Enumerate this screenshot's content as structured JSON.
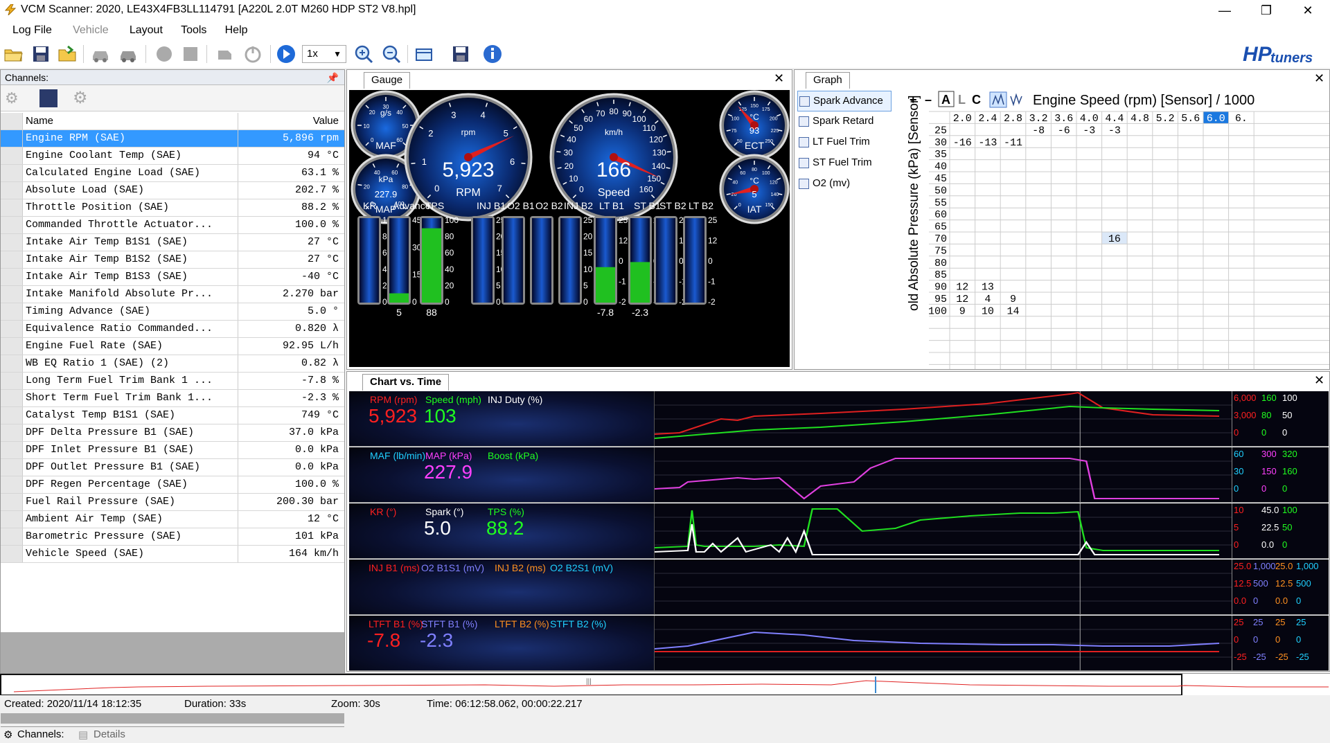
{
  "window": {
    "title": "VCM Scanner: 2020, LE43X4FB3LL114791 [A220L 2.0T M260 HDP ST2 V8.hpl]"
  },
  "menu": [
    "Log File",
    "Vehicle",
    "Layout",
    "Tools",
    "Help"
  ],
  "toolbar": {
    "speed": "1x",
    "logo": "HPtuners"
  },
  "channels": {
    "title": "Channels:",
    "header": {
      "name": "Name",
      "value": "Value"
    },
    "rows": [
      {
        "name": "Engine RPM (SAE)",
        "value": "5,896 rpm"
      },
      {
        "name": "Engine Coolant Temp (SAE)",
        "value": "94 °C"
      },
      {
        "name": "Calculated Engine Load (SAE)",
        "value": "63.1 %"
      },
      {
        "name": "Absolute Load (SAE)",
        "value": "202.7 %"
      },
      {
        "name": "Throttle Position (SAE)",
        "value": "88.2 %"
      },
      {
        "name": "Commanded Throttle Actuator...",
        "value": "100.0 %"
      },
      {
        "name": "Intake Air Temp B1S1 (SAE)",
        "value": "27 °C"
      },
      {
        "name": "Intake Air Temp B1S2 (SAE)",
        "value": "27 °C"
      },
      {
        "name": "Intake Air Temp B1S3 (SAE)",
        "value": "-40 °C"
      },
      {
        "name": "Intake Manifold Absolute Pr...",
        "value": "2.270 bar"
      },
      {
        "name": "Timing Advance (SAE)",
        "value": "5.0 °"
      },
      {
        "name": "Equivalence Ratio Commanded...",
        "value": "0.820 λ"
      },
      {
        "name": "Engine Fuel Rate (SAE)",
        "value": "92.95 L/h"
      },
      {
        "name": "WB EQ Ratio 1 (SAE) (2)",
        "value": "0.82 λ"
      },
      {
        "name": "Long Term Fuel Trim Bank 1 ...",
        "value": "-7.8 %"
      },
      {
        "name": "Short Term Fuel Trim Bank 1...",
        "value": "-2.3 %"
      },
      {
        "name": "Catalyst Temp B1S1 (SAE)",
        "value": "749 °C"
      },
      {
        "name": "DPF Delta Pressure B1 (SAE)",
        "value": "37.0 kPa"
      },
      {
        "name": "DPF Inlet Pressure B1 (SAE)",
        "value": "0.0 kPa"
      },
      {
        "name": "DPF Outlet Pressure B1 (SAE)",
        "value": "0.0 kPa"
      },
      {
        "name": "DPF Regen Percentage (SAE)",
        "value": "100.0 %"
      },
      {
        "name": "Fuel Rail Pressure (SAE)",
        "value": "200.30 bar"
      },
      {
        "name": "Ambient Air Temp (SAE)",
        "value": "12 °C"
      },
      {
        "name": "Barometric Pressure (SAE)",
        "value": "101 kPa"
      },
      {
        "name": "Vehicle Speed (SAE)",
        "value": "164 km/h"
      }
    ],
    "tabs": {
      "channels": "Channels:",
      "details": "Details"
    }
  },
  "gauge": {
    "tab": "Gauge",
    "rpm": {
      "unit": "rpm",
      "value": "5,923",
      "label": "RPM",
      "ticks": [
        "0",
        "1",
        "2",
        "3",
        "4",
        "5",
        "6",
        "7"
      ],
      "level": 5.923
    },
    "speed": {
      "unit": "km/h",
      "value": "166",
      "label": "Speed",
      "ticks": [
        "0",
        "10",
        "20",
        "30",
        "40",
        "50",
        "60",
        "70",
        "80",
        "90",
        "100",
        "110",
        "120",
        "130",
        "140",
        "150",
        "160"
      ],
      "level": 166
    },
    "maf": {
      "unit": "g/s",
      "label": "MAF",
      "ticks": [
        "0",
        "10",
        "20",
        "30",
        "40",
        "50",
        "60"
      ]
    },
    "map": {
      "unit": "kPa",
      "label": "MAP",
      "value": "227.9",
      "ticks": [
        "0",
        "20",
        "40",
        "60",
        "80",
        "100"
      ]
    },
    "ect": {
      "unit": "°C",
      "label": "ECT",
      "value": "93",
      "ticks": [
        "50",
        "75",
        "100",
        "125",
        "150",
        "175",
        "200",
        "225",
        "250"
      ]
    },
    "iat": {
      "unit": "°C",
      "label": "IAT",
      "value": "5",
      "ticks": [
        "0",
        "20",
        "40",
        "60",
        "80",
        "100",
        "120",
        "140",
        "150"
      ]
    },
    "bars": [
      {
        "label": "KR",
        "ticks": [
          "1",
          "8",
          "6",
          "4",
          "2",
          "0"
        ],
        "level": 0
      },
      {
        "label": "Advance",
        "ticks": [
          "45",
          "30",
          "15",
          "0"
        ],
        "level": 0.11,
        "value": "5"
      },
      {
        "label": "TPS",
        "ticks": [
          "100",
          "80",
          "60",
          "40",
          "20",
          "0"
        ],
        "level": 0.88,
        "value": "88"
      },
      {
        "label": "INJ B1",
        "ticks": [
          "25",
          "20",
          "15",
          "10",
          "5",
          "0"
        ],
        "level": 0
      },
      {
        "label": "O2 B1",
        "ticks": [],
        "level": 0
      },
      {
        "label": "O2 B2",
        "ticks": [],
        "level": 0
      },
      {
        "label": "INJ B2",
        "ticks": [
          "25",
          "20",
          "15",
          "10",
          "5",
          "0"
        ],
        "level": 0
      },
      {
        "label": "LT B1",
        "ticks": [
          "25",
          "12",
          "0",
          "-1",
          "-2"
        ],
        "level": 0.42,
        "value": "-7.8"
      },
      {
        "label": "ST B1",
        "ticks": [
          "25",
          "12",
          "0",
          "-1",
          "-2"
        ],
        "level": 0.48,
        "value": "-2.3"
      },
      {
        "label": "ST B2",
        "ticks": [
          "25",
          "12",
          "0",
          "-1",
          "-2"
        ],
        "level": 0
      },
      {
        "label": "LT B2",
        "ticks": [
          "25",
          "12",
          "0",
          "-1",
          "-2"
        ],
        "level": 0
      }
    ]
  },
  "graph": {
    "tab": "Graph",
    "items": [
      "Spark Advance",
      "Spark Retard",
      "LT Fuel Trim",
      "ST Fuel Trim",
      "O2 (mv)"
    ],
    "modes": [
      "+",
      "–",
      "A",
      "L",
      "C"
    ],
    "title": "Engine Speed (rpm) [Sensor] / 1000",
    "yaxis": "old Absolute Pressure (kPa) [Sensor]",
    "cols": [
      "2.0",
      "2.4",
      "2.8",
      "3.2",
      "3.6",
      "4.0",
      "4.4",
      "4.8",
      "5.2",
      "5.6",
      "6.0",
      "6."
    ],
    "rows": [
      {
        "k": "25",
        "c": [
          "",
          "",
          "",
          "-8",
          "-6",
          "-3",
          "-3",
          "",
          "",
          "",
          "",
          ""
        ]
      },
      {
        "k": "30",
        "c": [
          "-16",
          "-13",
          "-11",
          "",
          "",
          "",
          "",
          "",
          "",
          "",
          "",
          ""
        ]
      },
      {
        "k": "35",
        "c": [
          "",
          "",
          "",
          "",
          "",
          "",
          "",
          "",
          "",
          "",
          "",
          ""
        ]
      },
      {
        "k": "40",
        "c": [
          "",
          "",
          "",
          "",
          "",
          "",
          "",
          "",
          "",
          "",
          "",
          ""
        ]
      },
      {
        "k": "45",
        "c": [
          "",
          "",
          "",
          "",
          "",
          "",
          "",
          "",
          "",
          "",
          "",
          ""
        ]
      },
      {
        "k": "50",
        "c": [
          "",
          "",
          "",
          "",
          "",
          "",
          "",
          "",
          "",
          "",
          "",
          ""
        ]
      },
      {
        "k": "55",
        "c": [
          "",
          "",
          "",
          "",
          "",
          "",
          "",
          "",
          "",
          "",
          "",
          ""
        ]
      },
      {
        "k": "60",
        "c": [
          "",
          "",
          "",
          "",
          "",
          "",
          "",
          "",
          "",
          "",
          "",
          ""
        ]
      },
      {
        "k": "65",
        "c": [
          "",
          "",
          "",
          "",
          "",
          "",
          "",
          "",
          "",
          "",
          "",
          ""
        ]
      },
      {
        "k": "70",
        "c": [
          "",
          "",
          "",
          "",
          "",
          "",
          "16",
          "",
          "",
          "",
          "",
          ""
        ]
      },
      {
        "k": "75",
        "c": [
          "",
          "",
          "",
          "",
          "",
          "",
          "",
          "",
          "",
          "",
          "",
          ""
        ]
      },
      {
        "k": "80",
        "c": [
          "",
          "",
          "",
          "",
          "",
          "",
          "",
          "",
          "",
          "",
          "",
          ""
        ]
      },
      {
        "k": "85",
        "c": [
          "",
          "",
          "",
          "",
          "",
          "",
          "",
          "",
          "",
          "",
          "",
          ""
        ]
      },
      {
        "k": "90",
        "c": [
          "12",
          "13",
          "",
          "",
          "",
          "",
          "",
          "",
          "",
          "",
          "",
          ""
        ]
      },
      {
        "k": "95",
        "c": [
          "12",
          "4",
          "9",
          "",
          "",
          "",
          "",
          "",
          "",
          "",
          "",
          ""
        ]
      },
      {
        "k": "100",
        "c": [
          "9",
          "10",
          "14",
          "",
          "",
          "",
          "",
          "",
          "",
          "",
          "",
          ""
        ]
      }
    ]
  },
  "chart": {
    "tab": "Chart vs. Time",
    "rows": [
      {
        "labels": [
          {
            "t": "RPM (rpm)",
            "c": "#ff2020",
            "v": "5,923"
          },
          {
            "t": "Speed (mph)",
            "c": "#20ff20",
            "v": "103"
          },
          {
            "t": "INJ Duty (%)",
            "c": "#ffffff",
            "v": ""
          }
        ],
        "scale": [
          [
            "6,000",
            "#ff2020"
          ],
          [
            "160",
            "#20ff20"
          ],
          [
            "100",
            "#ffffff"
          ],
          [
            "3,000",
            "#ff2020"
          ],
          [
            "80",
            "#20ff20"
          ],
          [
            "50",
            "#ffffff"
          ],
          [
            "0",
            "#ff2020"
          ],
          [
            "0",
            "#20ff20"
          ],
          [
            "0",
            "#ffffff"
          ]
        ]
      },
      {
        "labels": [
          {
            "t": "MAF (lb/min)",
            "c": "#20d0ff",
            "v": ""
          },
          {
            "t": "MAP (kPa)",
            "c": "#ff40ff",
            "v": "227.9"
          },
          {
            "t": "Boost (kPa)",
            "c": "#20ff20",
            "v": ""
          }
        ],
        "scale": [
          [
            "60",
            "#20d0ff"
          ],
          [
            "300",
            "#ff40ff"
          ],
          [
            "320",
            "#20ff20"
          ],
          [
            "30",
            "#20d0ff"
          ],
          [
            "150",
            "#ff40ff"
          ],
          [
            "160",
            "#20ff20"
          ],
          [
            "0",
            "#20d0ff"
          ],
          [
            "0",
            "#ff40ff"
          ],
          [
            "0",
            "#20ff20"
          ]
        ]
      },
      {
        "labels": [
          {
            "t": "KR (°)",
            "c": "#ff2020",
            "v": ""
          },
          {
            "t": "Spark (°)",
            "c": "#ffffff",
            "v": "5.0"
          },
          {
            "t": "TPS (%)",
            "c": "#20ff20",
            "v": "88.2"
          }
        ],
        "scale": [
          [
            "10",
            "#ff2020"
          ],
          [
            "45.0",
            "#ffffff"
          ],
          [
            "100",
            "#20ff20"
          ],
          [
            "5",
            "#ff2020"
          ],
          [
            "22.5",
            "#ffffff"
          ],
          [
            "50",
            "#20ff20"
          ],
          [
            "0",
            "#ff2020"
          ],
          [
            "0.0",
            "#ffffff"
          ],
          [
            "0",
            "#20ff20"
          ]
        ]
      },
      {
        "labels": [
          {
            "t": "INJ B1 (ms)",
            "c": "#ff2020",
            "v": ""
          },
          {
            "t": "O2 B1S1 (mV)",
            "c": "#8080ff",
            "v": ""
          },
          {
            "t": "INJ B2 (ms)",
            "c": "#ff9020",
            "v": ""
          },
          {
            "t": "O2 B2S1 (mV)",
            "c": "#20d0ff",
            "v": ""
          }
        ],
        "scale": [
          [
            "25.0",
            "#ff2020"
          ],
          [
            "1,000",
            "#8080ff"
          ],
          [
            "25.0",
            "#ff9020"
          ],
          [
            "1,000",
            "#20d0ff"
          ],
          [
            "12.5",
            "#ff2020"
          ],
          [
            "500",
            "#8080ff"
          ],
          [
            "12.5",
            "#ff9020"
          ],
          [
            "500",
            "#20d0ff"
          ],
          [
            "0.0",
            "#ff2020"
          ],
          [
            "0",
            "#8080ff"
          ],
          [
            "0.0",
            "#ff9020"
          ],
          [
            "0",
            "#20d0ff"
          ]
        ]
      },
      {
        "labels": [
          {
            "t": "LTFT B1 (%)",
            "c": "#ff2020",
            "v": "-7.8"
          },
          {
            "t": "STFT B1 (%)",
            "c": "#8080ff",
            "v": "-2.3"
          },
          {
            "t": "LTFT B2 (%)",
            "c": "#ff9020",
            "v": ""
          },
          {
            "t": "STFT B2 (%)",
            "c": "#20d0ff",
            "v": ""
          }
        ],
        "scale": [
          [
            "25",
            "#ff2020"
          ],
          [
            "25",
            "#8080ff"
          ],
          [
            "25",
            "#ff9020"
          ],
          [
            "25",
            "#20d0ff"
          ],
          [
            "0",
            "#ff2020"
          ],
          [
            "0",
            "#8080ff"
          ],
          [
            "0",
            "#ff9020"
          ],
          [
            "0",
            "#20d0ff"
          ],
          [
            "-25",
            "#ff2020"
          ],
          [
            "-25",
            "#8080ff"
          ],
          [
            "-25",
            "#ff9020"
          ],
          [
            "-25",
            "#20d0ff"
          ]
        ]
      }
    ]
  },
  "status": {
    "created": "Created: 2020/11/14 18:12:35",
    "duration": "Duration: 33s",
    "zoom": "Zoom: 30s",
    "time": "Time: 06:12:58.062, 00:00:22.217"
  }
}
